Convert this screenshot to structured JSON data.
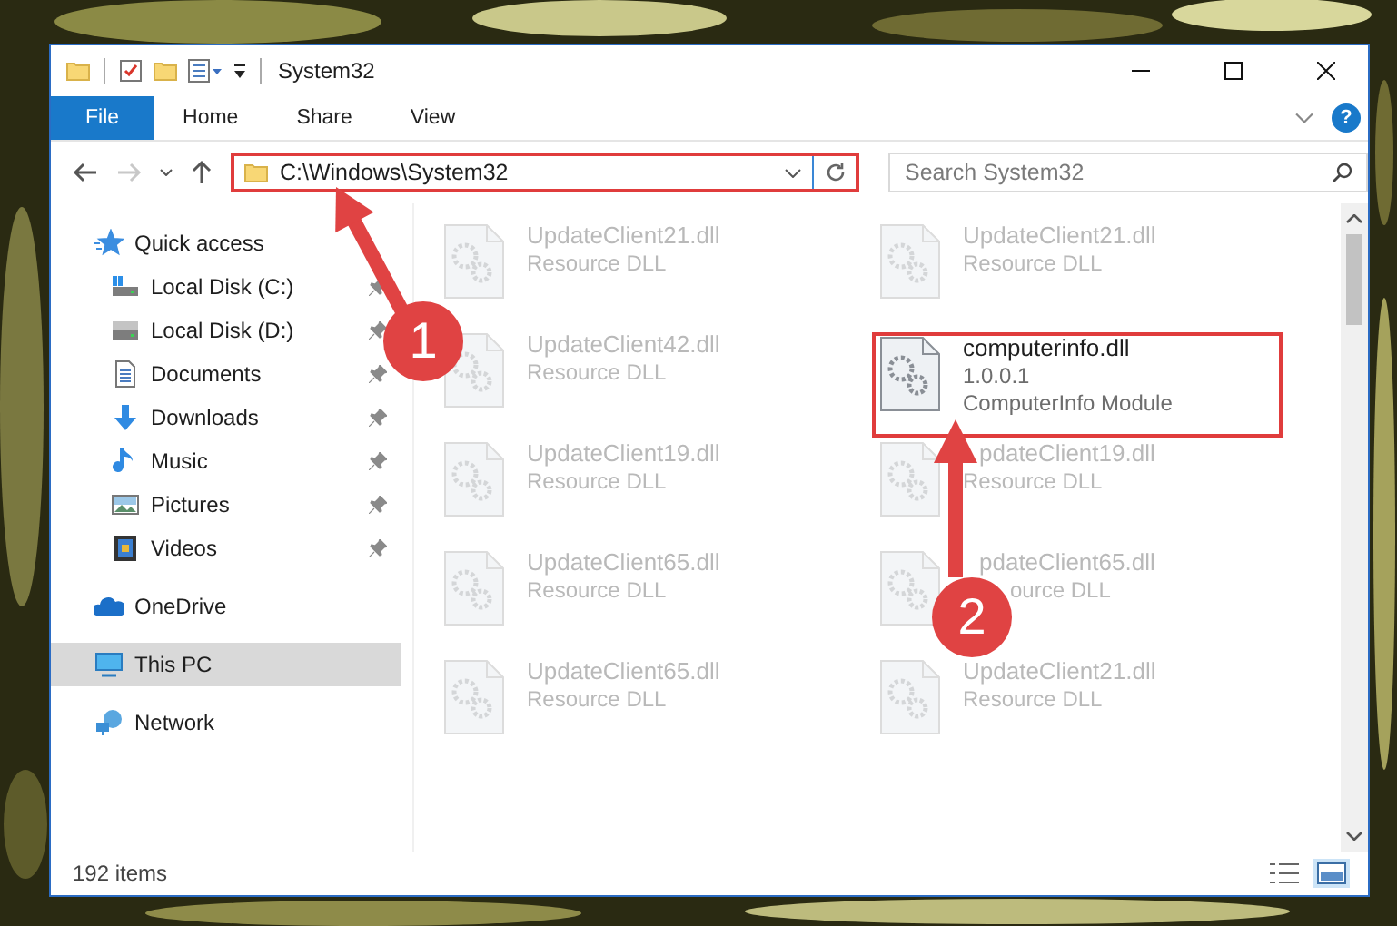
{
  "window": {
    "title": "System32"
  },
  "ribbon": {
    "tabs": [
      {
        "label": "File",
        "selected": true
      },
      {
        "label": "Home",
        "selected": false
      },
      {
        "label": "Share",
        "selected": false
      },
      {
        "label": "View",
        "selected": false
      }
    ],
    "help": "?"
  },
  "address": {
    "path": "C:\\Windows\\System32",
    "highlighted": true,
    "forward_disabled": true
  },
  "search": {
    "placeholder": "Search System32"
  },
  "sidebar": {
    "items": [
      {
        "label": "Quick access",
        "kind": "star",
        "selected": false,
        "children": [
          {
            "label": "Local Disk (C:)",
            "kind": "drive-c",
            "pinned": true,
            "selected": false
          },
          {
            "label": "Local Disk (D:)",
            "kind": "drive",
            "pinned": true,
            "selected": false
          },
          {
            "label": "Documents",
            "kind": "documents",
            "pinned": true,
            "selected": false
          },
          {
            "label": "Downloads",
            "kind": "downloads",
            "pinned": true,
            "selected": false
          },
          {
            "label": "Music",
            "kind": "music",
            "pinned": true,
            "selected": false
          },
          {
            "label": "Pictures",
            "kind": "pictures",
            "pinned": true,
            "selected": false
          },
          {
            "label": "Videos",
            "kind": "videos",
            "pinned": true,
            "selected": false
          }
        ]
      },
      {
        "label": "OneDrive",
        "kind": "cloud",
        "selected": false
      },
      {
        "label": "This PC",
        "kind": "pc",
        "selected": true
      },
      {
        "label": "Network",
        "kind": "network",
        "selected": false
      }
    ]
  },
  "files": [
    {
      "name": "UpdateClient21.dll",
      "lines": [
        "Resource DLL"
      ],
      "faded": true,
      "highlighted": false,
      "name_covered": false,
      "detail_covered": false
    },
    {
      "name": "UpdateClient21.dll",
      "lines": [
        "Resource DLL"
      ],
      "faded": true,
      "highlighted": false,
      "name_covered": false,
      "detail_covered": false
    },
    {
      "name": "UpdateClient42.dll",
      "lines": [
        "Resource DLL"
      ],
      "faded": true,
      "highlighted": false,
      "name_covered": false,
      "detail_covered": false
    },
    {
      "name": "computerinfo.dll",
      "lines": [
        "1.0.0.1",
        "ComputerInfo Module"
      ],
      "faded": false,
      "highlighted": true,
      "name_covered": false,
      "detail_covered": false
    },
    {
      "name": "UpdateClient19.dll",
      "lines": [
        "Resource DLL"
      ],
      "faded": true,
      "highlighted": false,
      "name_covered": false,
      "detail_covered": false
    },
    {
      "name": "pdateClient19.dll",
      "lines": [
        "Resource DLL"
      ],
      "faded": true,
      "highlighted": false,
      "name_covered": true,
      "detail_covered": false
    },
    {
      "name": "UpdateClient65.dll",
      "lines": [
        "Resource DLL"
      ],
      "faded": true,
      "highlighted": false,
      "name_covered": false,
      "detail_covered": false
    },
    {
      "name": "pdateClient65.dll",
      "lines": [
        "ource DLL"
      ],
      "faded": true,
      "highlighted": false,
      "name_covered": true,
      "detail_covered": true
    },
    {
      "name": "UpdateClient65.dll",
      "lines": [
        "Resource DLL"
      ],
      "faded": true,
      "highlighted": false,
      "name_covered": false,
      "detail_covered": false
    },
    {
      "name": "UpdateClient21.dll",
      "lines": [
        "Resource DLL"
      ],
      "faded": true,
      "highlighted": false,
      "name_covered": false,
      "detail_covered": false
    }
  ],
  "status_bar": {
    "count": "192 items",
    "view_buttons": [
      {
        "kind": "details",
        "selected": false
      },
      {
        "kind": "large-icons",
        "selected": true
      }
    ]
  },
  "annotations": [
    {
      "label": "1"
    },
    {
      "label": "2"
    }
  ]
}
